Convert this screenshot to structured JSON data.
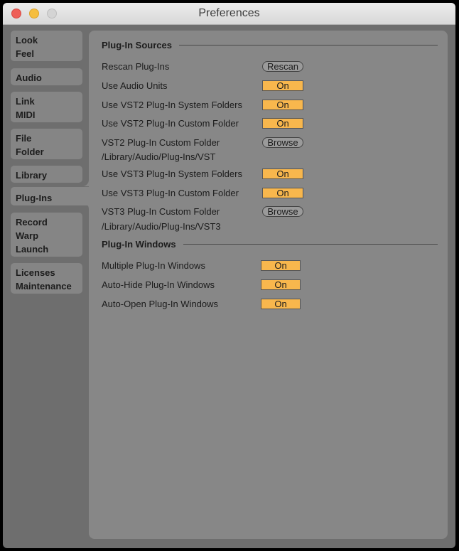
{
  "window": {
    "title": "Preferences"
  },
  "sidebar": {
    "tabs": [
      {
        "lines": [
          "Look",
          "Feel"
        ]
      },
      {
        "lines": [
          "Audio"
        ]
      },
      {
        "lines": [
          "Link",
          "MIDI"
        ]
      },
      {
        "lines": [
          "File",
          "Folder"
        ]
      },
      {
        "lines": [
          "Library"
        ]
      },
      {
        "lines": [
          "Plug-Ins"
        ],
        "selected": true
      },
      {
        "lines": [
          "Record",
          "Warp",
          "Launch"
        ]
      },
      {
        "lines": [
          "Licenses",
          "Maintenance"
        ]
      }
    ]
  },
  "sections": {
    "sources": {
      "title": "Plug-In Sources",
      "rescan": {
        "label": "Rescan Plug-Ins",
        "button": "Rescan"
      },
      "audio_units": {
        "label": "Use Audio Units",
        "value": "On"
      },
      "vst2_system": {
        "label": "Use VST2 Plug-In System Folders",
        "value": "On"
      },
      "vst2_custom": {
        "label": "Use VST2 Plug-In Custom Folder",
        "value": "On"
      },
      "vst2_folder": {
        "label": "VST2 Plug-In Custom Folder",
        "path": "/Library/Audio/Plug-Ins/VST",
        "button": "Browse"
      },
      "vst3_system": {
        "label": "Use VST3 Plug-In System Folders",
        "value": "On"
      },
      "vst3_custom": {
        "label": "Use VST3 Plug-In Custom Folder",
        "value": "On"
      },
      "vst3_folder": {
        "label": "VST3 Plug-In Custom Folder",
        "path": "/Library/Audio/Plug-Ins/VST3",
        "button": "Browse"
      }
    },
    "windows": {
      "title": "Plug-In Windows",
      "multiple": {
        "label": "Multiple Plug-In Windows",
        "value": "On"
      },
      "auto_hide": {
        "label": "Auto-Hide Plug-In Windows",
        "value": "On"
      },
      "auto_open": {
        "label": "Auto-Open Plug-In Windows",
        "value": "On"
      }
    }
  },
  "colors": {
    "toggle_on": "#f8b74d",
    "panel": "#878787",
    "frame": "#6e6e6e"
  }
}
